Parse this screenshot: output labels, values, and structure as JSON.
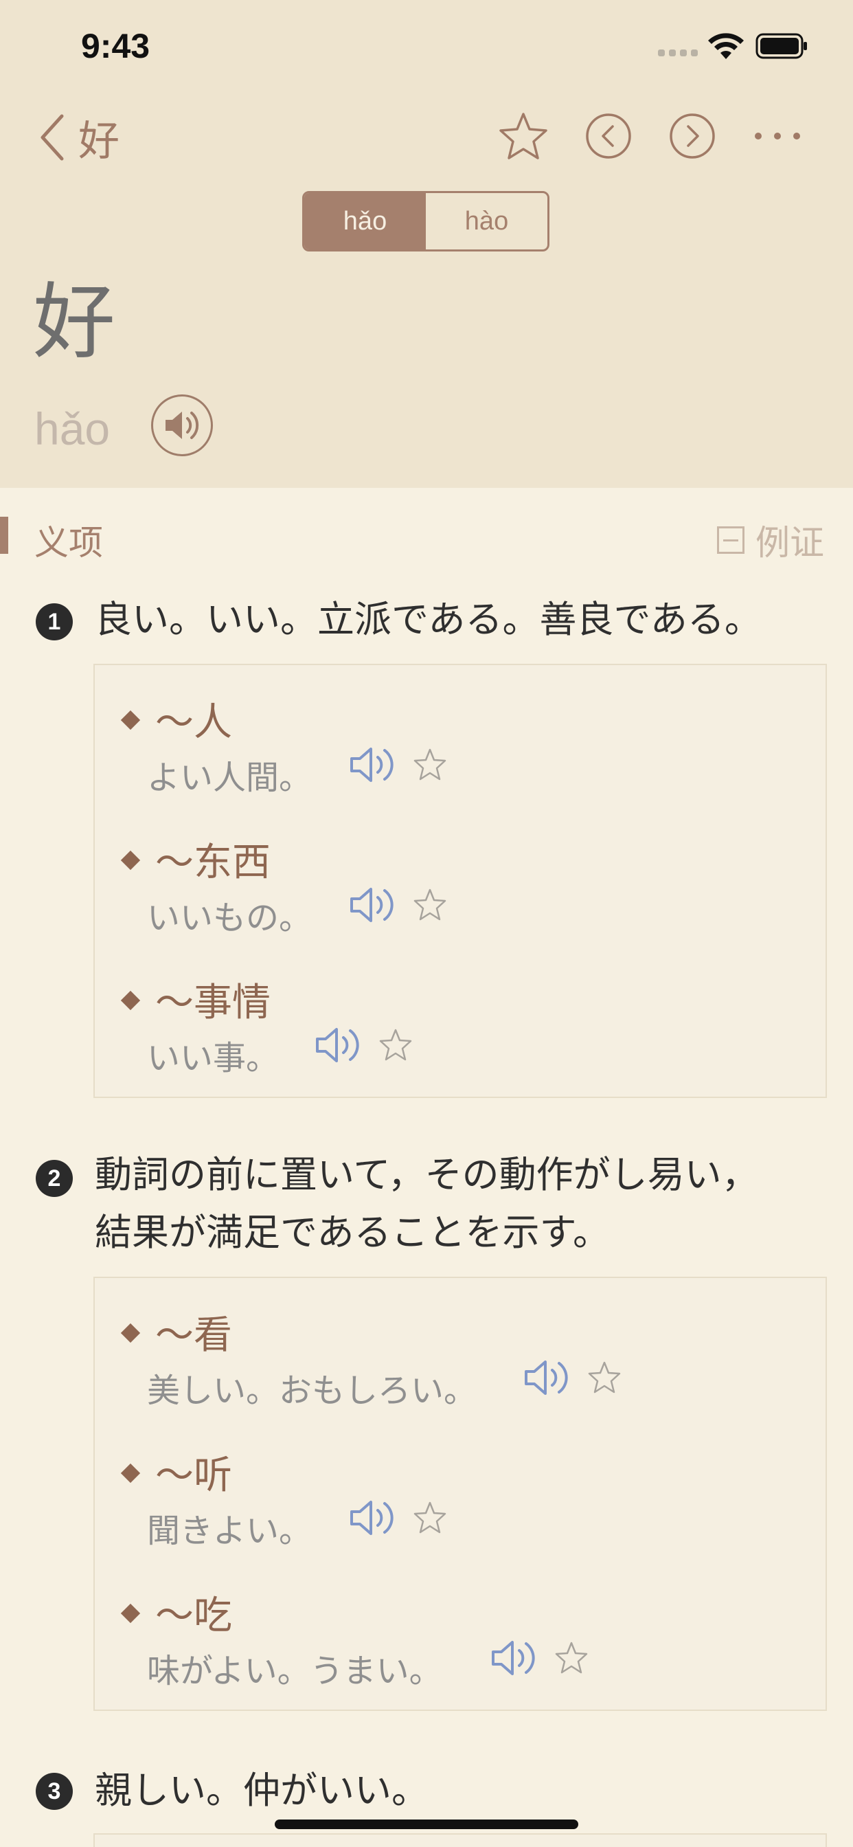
{
  "status": {
    "time": "9:43"
  },
  "nav": {
    "back_title": "好"
  },
  "segments": [
    {
      "label": "hǎo",
      "active": true
    },
    {
      "label": "hào",
      "active": false
    }
  ],
  "entry": {
    "character": "好",
    "pinyin": "hǎo"
  },
  "section": {
    "title": "义项",
    "examples_label": "例证"
  },
  "senses": [
    {
      "number": "1",
      "definition": "良い。いい。立派である。善良である。",
      "examples": [
        {
          "word": "～人",
          "translation": "よい人間。"
        },
        {
          "word": "～东西",
          "translation": "いいもの。"
        },
        {
          "word": "～事情",
          "translation": "いい事。"
        }
      ]
    },
    {
      "number": "2",
      "definition": "動詞の前に置いて，その動作がし易い，結果が満足であることを示す。",
      "examples": [
        {
          "word": "～看",
          "translation": "美しい。おもしろい。"
        },
        {
          "word": "～听",
          "translation": "聞きよい。"
        },
        {
          "word": "～吃",
          "translation": "味がよい。うまい。"
        }
      ]
    },
    {
      "number": "3",
      "definition": "親しい。仲がいい。",
      "examples": []
    }
  ],
  "colors": {
    "accent": "#a5806d",
    "speaker_blue": "#7f96c8",
    "header_bg": "#eee4cf",
    "body_bg": "#f7f1e2"
  }
}
